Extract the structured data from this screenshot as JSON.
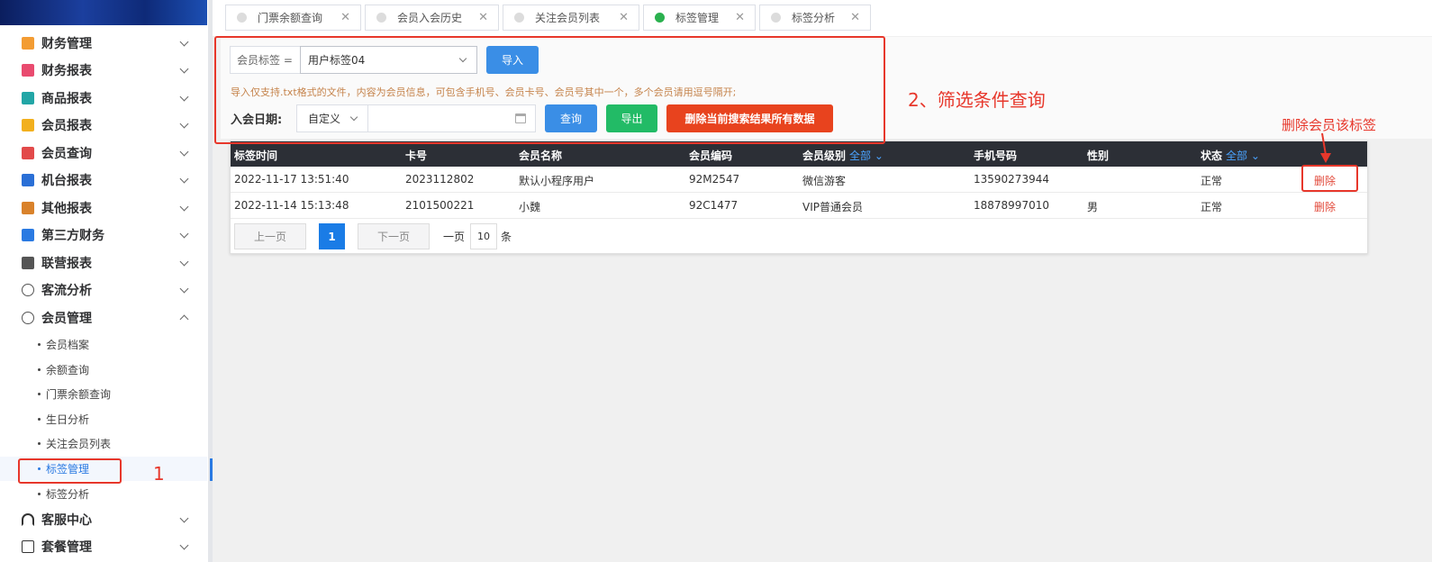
{
  "sidebar": {
    "menu": [
      {
        "label": "财务管理",
        "icon": "finance-book-icon",
        "color": "#f39c33"
      },
      {
        "label": "财务报表",
        "icon": "report-book-icon",
        "color": "#e94b6f"
      },
      {
        "label": "商品报表",
        "icon": "goods-report-icon",
        "color": "#22a6a6"
      },
      {
        "label": "会员报表",
        "icon": "member-report-icon",
        "color": "#f2b01e"
      },
      {
        "label": "会员查询",
        "icon": "member-search-icon",
        "color": "#e24a4a"
      },
      {
        "label": "机台报表",
        "icon": "machine-report-icon",
        "color": "#2a6fd6"
      },
      {
        "label": "其他报表",
        "icon": "layers-icon",
        "color": "#d9822b"
      },
      {
        "label": "第三方财务",
        "icon": "calculator-icon",
        "color": "#2a7ae2"
      },
      {
        "label": "联营报表",
        "icon": "users-icon",
        "color": "#555555"
      },
      {
        "label": "客流分析",
        "icon": "target-icon",
        "color": "#555555"
      },
      {
        "label": "会员管理",
        "icon": "member-badge-icon",
        "color": "#555555"
      }
    ],
    "sub_items": [
      "会员档案",
      "余额查询",
      "门票余额查询",
      "生日分析",
      "关注会员列表",
      "标签管理",
      "标签分析"
    ],
    "after_menu": [
      {
        "label": "客服中心",
        "icon": "headset-icon",
        "color": "#333333"
      },
      {
        "label": "套餐管理",
        "icon": "edit-icon",
        "color": "#333333"
      }
    ]
  },
  "tabs": [
    {
      "label": "门票余额查询",
      "active": false
    },
    {
      "label": "会员入会历史",
      "active": false
    },
    {
      "label": "关注会员列表",
      "active": false
    },
    {
      "label": "标签管理",
      "active": true
    },
    {
      "label": "标签分析",
      "active": false
    }
  ],
  "filter": {
    "tag_label": "会员标签 =",
    "tag_value": "用户标签04",
    "import_label": "导入",
    "hint": "导入仅支持.txt格式的文件，内容为会员信息，可包含手机号、会员卡号、会员号其中一个，多个会员请用逗号隔开;",
    "date_label": "入会日期:",
    "date_mode": "自定义",
    "query_label": "查询",
    "export_label": "导出",
    "delete_all_label": "删除当前搜索结果所有数据"
  },
  "annotations": {
    "step2": "2、筛选条件查询",
    "delete_note": "删除会员该标签",
    "step1": "1"
  },
  "table": {
    "headers": [
      "标签时间",
      "卡号",
      "会员名称",
      "会员编码",
      "会员级别",
      "手机号码",
      "性别",
      "状态"
    ],
    "level_filter": "全部",
    "status_filter": "全部",
    "rows": [
      [
        "2022-11-17 13:51:40",
        "2023112802",
        "默认小程序用户",
        "92M2547",
        "微信游客",
        "13590273944",
        "",
        "正常",
        "删除"
      ],
      [
        "2022-11-14 15:13:48",
        "2101500221",
        "小魏",
        "92C1477",
        "VIP普通会员",
        "18878997010",
        "男",
        "正常",
        "删除"
      ]
    ]
  },
  "pagination": {
    "prev": "上一页",
    "current": "1",
    "next": "下一页",
    "per_page_prefix": "一页",
    "per_page": "10",
    "per_page_suffix": "条"
  }
}
